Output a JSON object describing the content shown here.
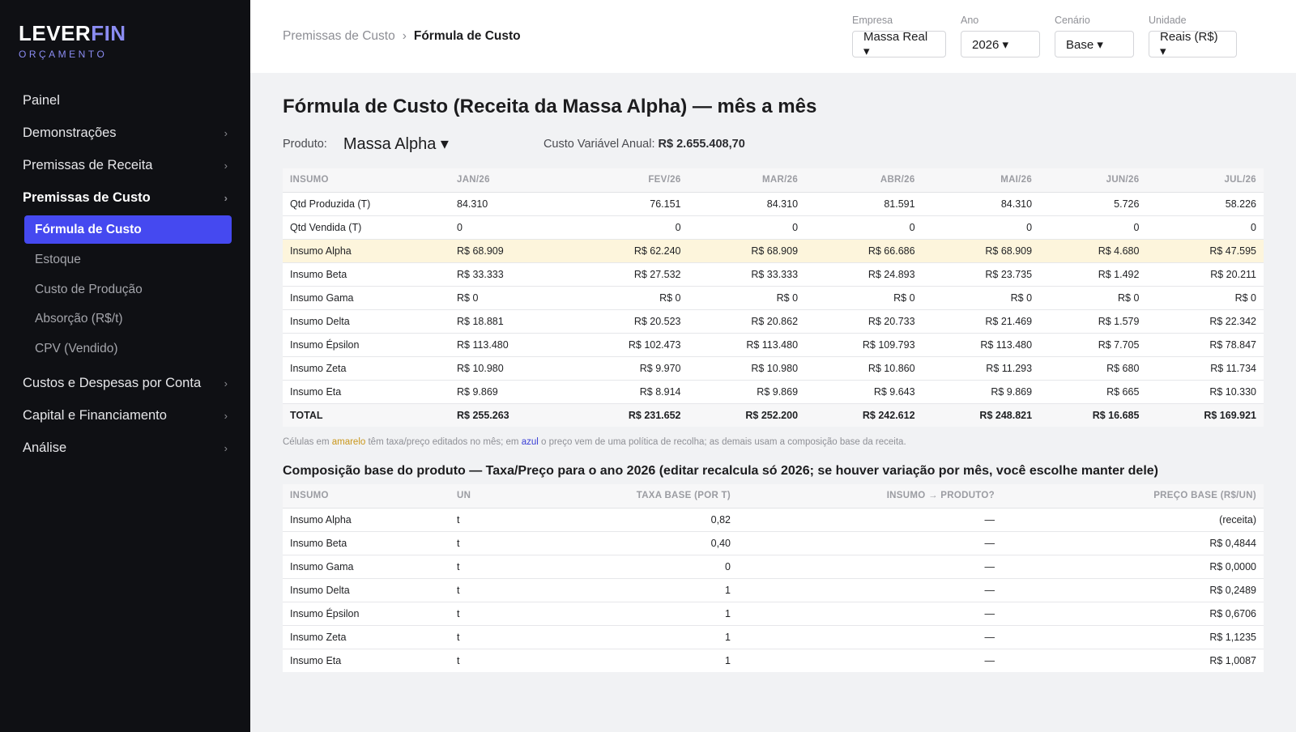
{
  "brand": {
    "name_part1": "LEVER",
    "name_part2": "FIN",
    "subtitle": "ORÇAMENTO",
    "accent_color": "#8b8cf2"
  },
  "sidebar": {
    "items": [
      {
        "label": "Painel",
        "chevron": false
      },
      {
        "label": "Demonstrações",
        "chevron": true
      },
      {
        "label": "Premissas de Receita",
        "chevron": true
      },
      {
        "label": "Premissas de Custo",
        "chevron": true,
        "active": true,
        "children": [
          "Fórmula de Custo",
          "Estoque",
          "Custo de Produção",
          "Absorção (R$/t)",
          "CPV (Vendido)"
        ],
        "selected_child": "Fórmula de Custo"
      },
      {
        "label": "Custos e Despesas por Conta",
        "chevron": true
      },
      {
        "label": "Capital e Financiamento",
        "chevron": true
      },
      {
        "label": "Análise",
        "chevron": true
      }
    ],
    "chevron_glyph": "›",
    "selected_color": "#4549f0"
  },
  "breadcrumb": {
    "parent": "Premissas de Custo",
    "separator": "›",
    "current": "Fórmula de Custo"
  },
  "filters": {
    "empresa": {
      "label": "Empresa",
      "value": "Massa Real ▾"
    },
    "ano": {
      "label": "Ano",
      "value": "2026 ▾"
    },
    "cenario": {
      "label": "Cenário",
      "value": "Base ▾"
    },
    "unidade": {
      "label": "Unidade",
      "value": "Reais (R$) ▾"
    }
  },
  "main": {
    "title": "Fórmula de Custo (Receita da Massa Alpha) — mês a mês",
    "product_label": "Produto:",
    "product_value": "Massa Alpha ▾",
    "annual_label": "Custo Variável Anual:",
    "annual_value": "R$ 2.655.408,70"
  },
  "monthly_table": {
    "headers": [
      "INSUMO",
      "JAN/26",
      "FEV/26",
      "MAR/26",
      "ABR/26",
      "MAI/26",
      "JUN/26",
      "JUL/26"
    ],
    "highlight_color": "#fdf5dc",
    "rows": [
      {
        "cells": [
          "Qtd Produzida (T)",
          "84.310",
          "76.151",
          "84.310",
          "81.591",
          "84.310",
          "5.726",
          "58.226"
        ]
      },
      {
        "cells": [
          "Qtd Vendida (T)",
          "0",
          "0",
          "0",
          "0",
          "0",
          "0",
          "0"
        ]
      },
      {
        "cells": [
          "Insumo Alpha",
          "R$ 68.909",
          "R$ 62.240",
          "R$ 68.909",
          "R$ 66.686",
          "R$ 68.909",
          "R$ 4.680",
          "R$ 47.595"
        ],
        "highlight": true
      },
      {
        "cells": [
          "Insumo Beta",
          "R$ 33.333",
          "R$ 27.532",
          "R$ 33.333",
          "R$ 24.893",
          "R$ 23.735",
          "R$ 1.492",
          "R$ 20.211"
        ]
      },
      {
        "cells": [
          "Insumo Gama",
          "R$ 0",
          "R$ 0",
          "R$ 0",
          "R$ 0",
          "R$ 0",
          "R$ 0",
          "R$ 0"
        ]
      },
      {
        "cells": [
          "Insumo Delta",
          "R$ 18.881",
          "R$ 20.523",
          "R$ 20.862",
          "R$ 20.733",
          "R$ 21.469",
          "R$ 1.579",
          "R$ 22.342"
        ]
      },
      {
        "cells": [
          "Insumo Épsilon",
          "R$ 113.480",
          "R$ 102.473",
          "R$ 113.480",
          "R$ 109.793",
          "R$ 113.480",
          "R$ 7.705",
          "R$ 78.847"
        ]
      },
      {
        "cells": [
          "Insumo Zeta",
          "R$ 10.980",
          "R$ 9.970",
          "R$ 10.980",
          "R$ 10.860",
          "R$ 11.293",
          "R$ 680",
          "R$ 11.734"
        ]
      },
      {
        "cells": [
          "Insumo Eta",
          "R$ 9.869",
          "R$ 8.914",
          "R$ 9.869",
          "R$ 9.643",
          "R$ 9.869",
          "R$ 665",
          "R$ 10.330"
        ]
      },
      {
        "cells": [
          "TOTAL",
          "R$ 255.263",
          "R$ 231.652",
          "R$ 252.200",
          "R$ 242.612",
          "R$ 248.821",
          "R$ 16.685",
          "R$ 169.921"
        ],
        "total": true
      }
    ]
  },
  "note": {
    "part1": "Células em ",
    "yellow": "amarelo",
    "part2": " têm taxa/preço editados no mês; em ",
    "blue": "azul",
    "part3": " o preço vem de uma política de recolha; as demais usam a composição base da receita."
  },
  "composition": {
    "title": "Composição base do produto — Taxa/Preço para o ano 2026 (editar recalcula só 2026; se houver variação por mês, você escolhe manter dele)",
    "headers": [
      "INSUMO",
      "UN",
      "TAXA BASE (POR T)",
      "INSUMO → PRODUTO?",
      "PREÇO BASE (R$/UN)"
    ],
    "rows": [
      [
        "Insumo Alpha",
        "t",
        "0,82",
        "—",
        "(receita)"
      ],
      [
        "Insumo Beta",
        "t",
        "0,40",
        "—",
        "R$ 0,4844"
      ],
      [
        "Insumo Gama",
        "t",
        "0",
        "—",
        "R$ 0,0000"
      ],
      [
        "Insumo Delta",
        "t",
        "1",
        "—",
        "R$ 0,2489"
      ],
      [
        "Insumo Épsilon",
        "t",
        "1",
        "—",
        "R$ 0,6706"
      ],
      [
        "Insumo Zeta",
        "t",
        "1",
        "—",
        "R$ 1,1235"
      ],
      [
        "Insumo Eta",
        "t",
        "1",
        "—",
        "R$ 1,0087"
      ]
    ]
  }
}
